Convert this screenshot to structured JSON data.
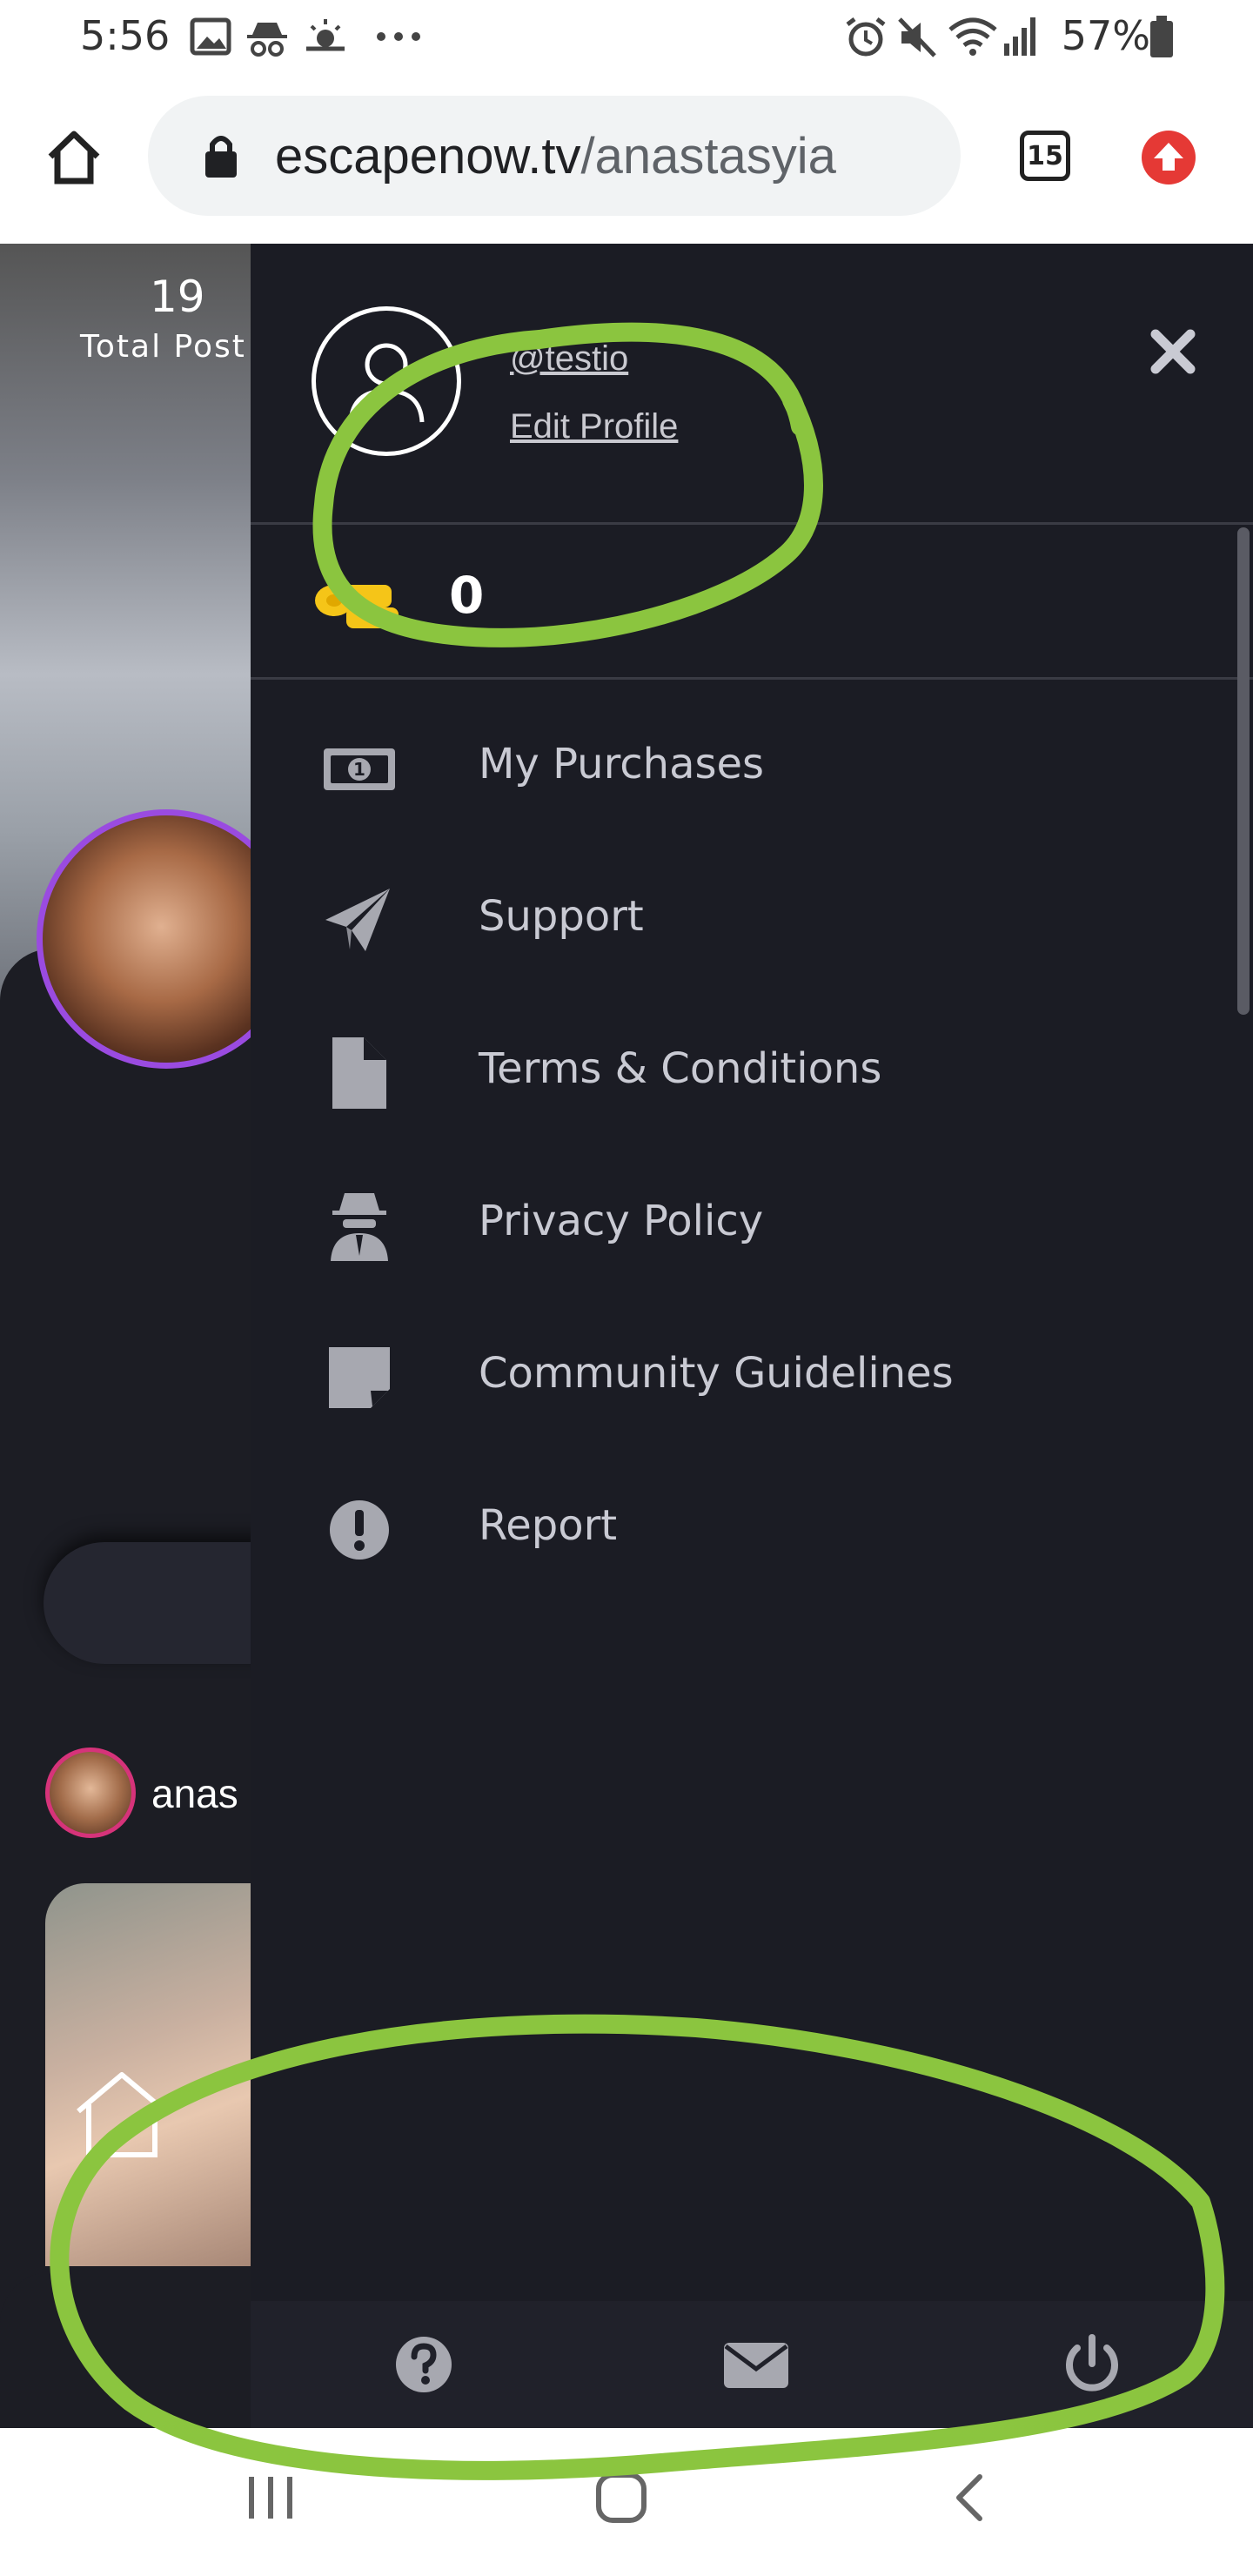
{
  "status_bar": {
    "time": "5:56",
    "battery": "57%",
    "icons": [
      "image-icon",
      "incognito-icon",
      "weather-icon",
      "more-icon",
      "alarm-icon",
      "mute-icon",
      "wifi-icon",
      "signal-icon",
      "battery-icon"
    ]
  },
  "browser": {
    "url_host": "escapenow.tv",
    "url_path": "/anastasyia",
    "tab_count": "15",
    "icons": [
      "home-icon",
      "lock-icon",
      "tabs-icon",
      "update-icon"
    ]
  },
  "background_page": {
    "stats_number": "19",
    "stats_label": "Total Post",
    "username": "anas"
  },
  "drawer": {
    "handle": "@testio",
    "edit_profile": "Edit Profile",
    "balance": "0",
    "menu": [
      {
        "label": "My Purchases",
        "icon": "money-icon"
      },
      {
        "label": "Support",
        "icon": "paper-plane-icon"
      },
      {
        "label": "Terms & Conditions",
        "icon": "file-icon"
      },
      {
        "label": "Privacy Policy",
        "icon": "spy-icon"
      },
      {
        "label": "Community Guidelines",
        "icon": "sticky-note-icon"
      },
      {
        "label": "Report",
        "icon": "exclamation-icon"
      }
    ],
    "footer_icons": [
      "help-icon",
      "mail-icon",
      "power-icon"
    ]
  },
  "colors": {
    "drawer_bg": "#1b1c24",
    "menu_text": "#c9cad3",
    "avatar_ring": "#9a4be0",
    "annotation_green": "#8bc53f",
    "update_red": "#e53935"
  }
}
